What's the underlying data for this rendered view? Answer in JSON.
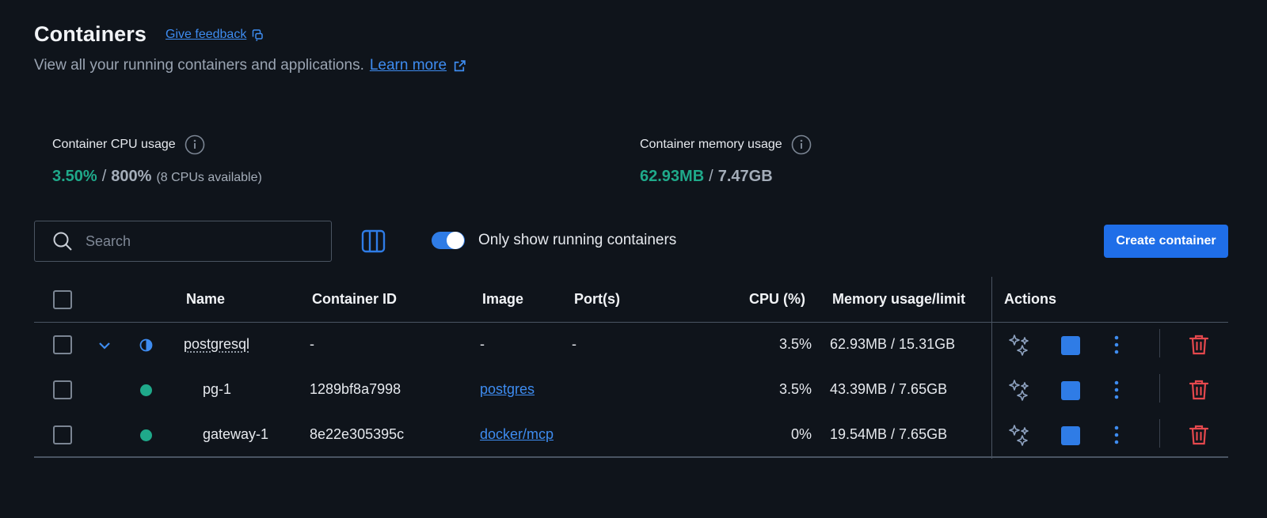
{
  "header": {
    "title": "Containers",
    "feedback_label": "Give feedback",
    "subtitle": "View all your running containers and applications.",
    "learn_more_label": "Learn more"
  },
  "stats": {
    "cpu": {
      "label": "Container CPU usage",
      "used": "3.50%",
      "total": "800%",
      "note": "(8 CPUs available)"
    },
    "memory": {
      "label": "Container memory usage",
      "used": "62.93MB",
      "total": "7.47GB"
    }
  },
  "toolbar": {
    "search_placeholder": "Search",
    "toggle_label": "Only show running containers",
    "toggle_on": true,
    "create_label": "Create container"
  },
  "table": {
    "columns": [
      "Name",
      "Container ID",
      "Image",
      "Port(s)",
      "CPU (%)",
      "Memory usage/limit",
      "Actions"
    ],
    "rows": [
      {
        "name": "postgresql",
        "id": "-",
        "image": "-",
        "ports": "-",
        "cpu": "3.5%",
        "memory": "62.93MB / 15.31GB"
      },
      {
        "name": "pg-1",
        "id": "1289bf8a7998",
        "image": "postgres",
        "ports": "",
        "cpu": "3.5%",
        "memory": "43.39MB / 7.65GB"
      },
      {
        "name": "gateway-1",
        "id": "8e22e305395c",
        "image": "docker/mcp",
        "ports": "",
        "cpu": "0%",
        "memory": "19.54MB / 7.65GB"
      }
    ]
  },
  "colors": {
    "background": "#0f141b",
    "accent": "#1f6ee8",
    "running": "#1fa98a",
    "danger": "#e5484d"
  }
}
